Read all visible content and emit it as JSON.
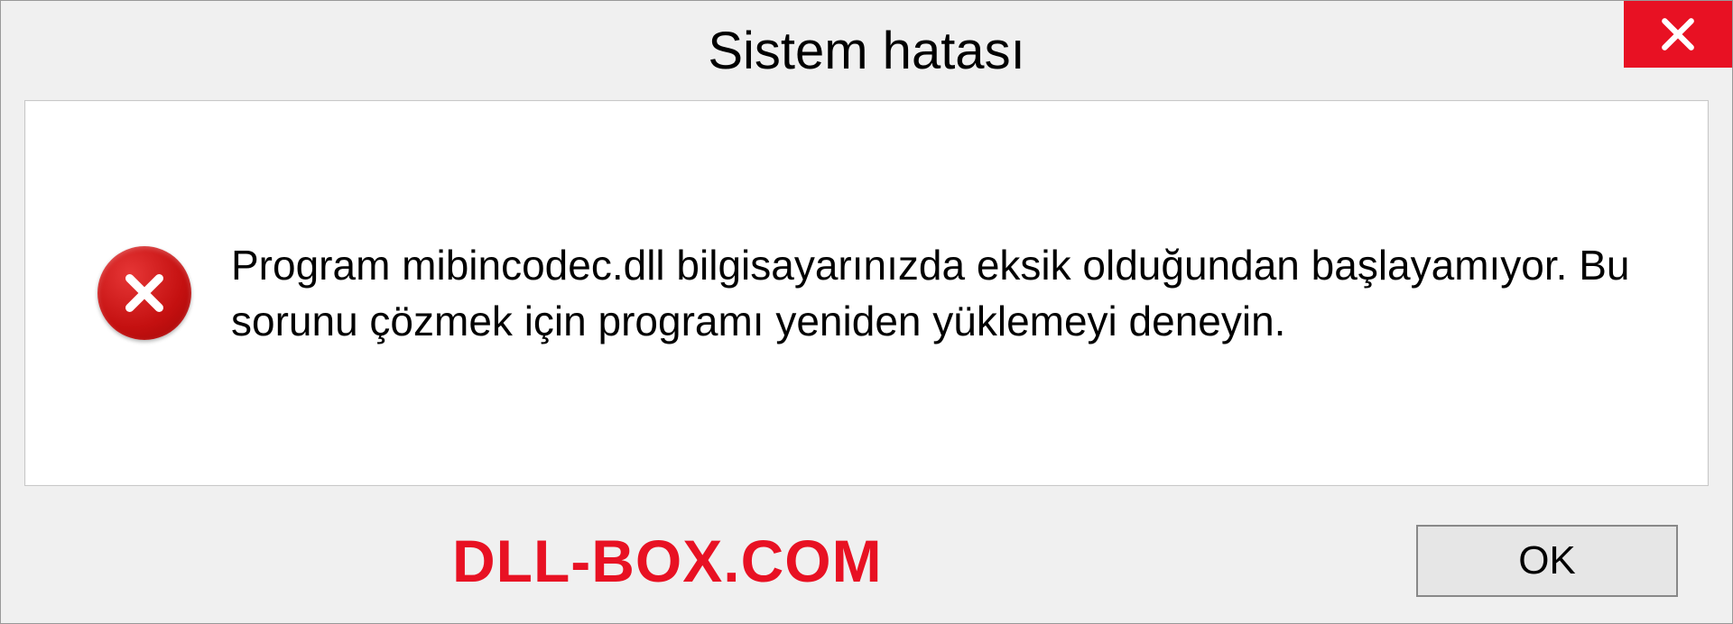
{
  "dialog": {
    "title": "Sistem hatası",
    "message": "Program mibincodec.dll bilgisayarınızda eksik olduğundan başlayamıyor. Bu sorunu çözmek için programı yeniden yüklemeyi deneyin.",
    "ok_label": "OK",
    "watermark": "DLL-BOX.COM"
  },
  "colors": {
    "close_bg": "#e81123",
    "error_icon": "#c41010",
    "watermark": "#e81123"
  }
}
